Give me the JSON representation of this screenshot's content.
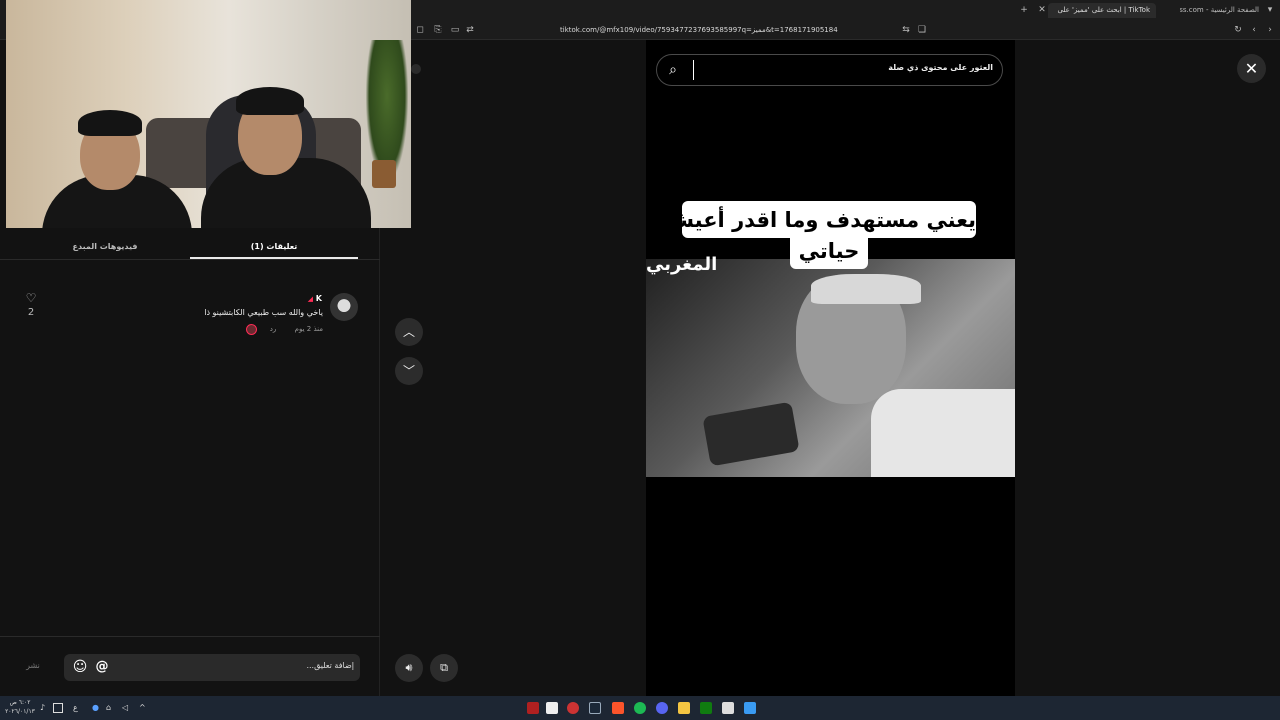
{
  "browser": {
    "tabs": [
      {
        "label": "الصفحة الرئيسية - Chess.com"
      },
      {
        "label": "TikTok | ابحث على 'مميز' على"
      }
    ],
    "url": "tiktok.com/@mfx109/video/7593477237693585997q=مميز&t=1768171905184"
  },
  "panel": {
    "tabs": [
      {
        "label": "فيديوهات المبدع"
      },
      {
        "label": "(1) تعليقات"
      }
    ],
    "comment": {
      "username": "K",
      "text": "ياخي والله سب طبيعي الكابتشينو ذا",
      "time": "منذ 2 يوم",
      "reply_label": "رد",
      "like_count": "2"
    },
    "input": {
      "placeholder": "إضافة تعليق...",
      "post_label": "نشر"
    }
  },
  "video": {
    "search_placeholder": "العثور على محتوى ذي صلة",
    "caption_line1": "يعني مستهدف وما اقدر أعيش",
    "caption_line2": "حياتي",
    "overlay_label": "المغربي"
  },
  "taskbar": {
    "clock_time": "٦:٠٢ ص",
    "clock_date": "٢٠٢٦/٠١/١٣",
    "lang": "ع"
  },
  "colors": {
    "background": "#121212",
    "video_bg": "#000000",
    "tiktok_red": "#fe2c55"
  }
}
